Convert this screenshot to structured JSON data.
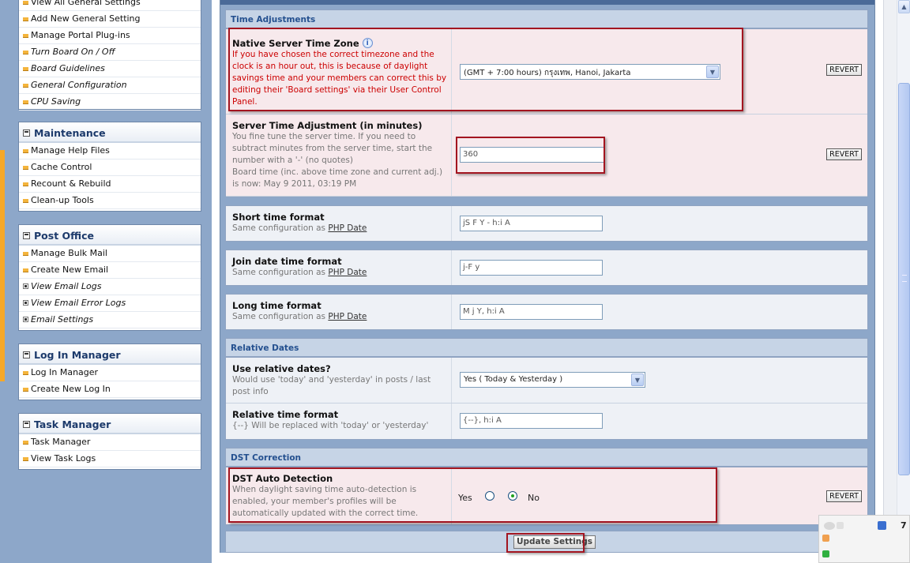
{
  "sidebar": {
    "settings_items": [
      {
        "label": "View All General Settings"
      },
      {
        "label": "Add New General Setting"
      },
      {
        "label": "Manage Portal Plug-ins"
      },
      {
        "label": "Turn Board On / Off"
      },
      {
        "label": "Board Guidelines"
      },
      {
        "label": "General Configuration"
      },
      {
        "label": "CPU Saving"
      }
    ],
    "maintenance": {
      "title": "Maintenance",
      "items": [
        "Manage Help Files",
        "Cache Control",
        "Recount & Rebuild",
        "Clean-up Tools"
      ]
    },
    "post_office": {
      "title": "Post Office",
      "items": [
        "Manage Bulk Mail",
        "Create New Email",
        "View Email Logs",
        "View Email Error Logs",
        "Email Settings"
      ]
    },
    "log_in_manager": {
      "title": "Log In Manager",
      "items": [
        "Log In Manager",
        "Create New Log In"
      ]
    },
    "task_manager": {
      "title": "Task Manager",
      "items": [
        "Task Manager",
        "View Task Logs"
      ]
    }
  },
  "sections": {
    "time_adjustments": "Time Adjustments",
    "relative_dates": "Relative Dates",
    "dst_correction": "DST Correction"
  },
  "settings": {
    "timezone": {
      "title": "Native Server Time Zone",
      "desc": "If you have chosen the correct timezone and the clock is an hour out, this is because of daylight savings time and your members can correct this by editing their 'Board settings' via their User Control Panel.",
      "value": "(GMT + 7:00 hours) กรุงเทพ, Hanoi, Jakarta"
    },
    "time_adjust": {
      "title": "Server Time Adjustment (in minutes)",
      "desc": "You fine tune the server time. If you need to subtract minutes from the server time, start the number with a '-' (no quotes)",
      "desc2": "Board time (inc. above time zone and current adj.) is now: May 9 2011, 03:19 PM",
      "value": "360"
    },
    "short_format": {
      "title": "Short time format",
      "desc": "Same configuration as",
      "link": "PHP Date",
      "value": "jS F Y - h:i A"
    },
    "join_format": {
      "title": "Join date time format",
      "desc": "Same configuration as",
      "link": "PHP Date",
      "value": "j-F y"
    },
    "long_format": {
      "title": "Long time format",
      "desc": "Same configuration as",
      "link": "PHP Date",
      "value": "M j Y, h:i A"
    },
    "use_relative": {
      "title": "Use relative dates?",
      "desc": "Would use 'today' and 'yesterday' in posts / last post info",
      "value": "Yes ( Today & Yesterday )"
    },
    "relative_format": {
      "title": "Relative time format",
      "desc": "{--} Will be replaced with 'today' or 'yesterday'",
      "value": "{--}, h:i A"
    },
    "dst": {
      "title": "DST Auto Detection",
      "desc": "When daylight saving time auto-detection is enabled, your member's profiles will be automatically updated with the correct time.",
      "yes": "Yes",
      "no": "No",
      "selected": "No"
    }
  },
  "revert_label": "REVERT",
  "info_label": "i",
  "update_button": "Update Settings",
  "tray": {
    "number": "7"
  },
  "colors": {
    "highlight": "#a31520",
    "sidebar_bg": "#8da7c9",
    "section_header": "#c6d4e6",
    "required_row": "#f7e9ec"
  }
}
